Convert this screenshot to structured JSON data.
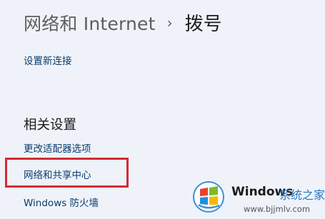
{
  "header": {
    "breadcrumb_parent": "网络和 Internet",
    "breadcrumb_separator": "›",
    "page_title": "拨号"
  },
  "main": {
    "new_connection_link": "设置新连接"
  },
  "related_settings": {
    "title": "相关设置",
    "links": [
      "更改适配器选项",
      "网络和共享中心",
      "Windows 防火墙"
    ]
  },
  "watermark": {
    "brand": "Windows",
    "chinese": "系统之家",
    "url": "www.bjjmlv.com"
  }
}
